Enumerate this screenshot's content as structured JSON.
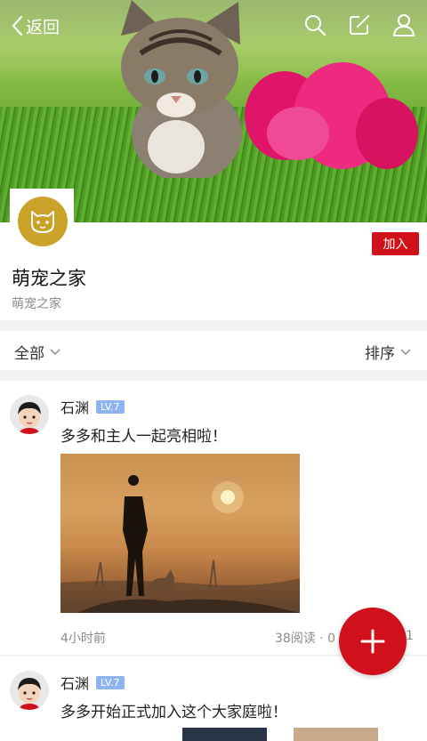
{
  "topbar": {
    "back_label": "返回",
    "icons": [
      "search-icon",
      "edit-icon",
      "user-icon"
    ]
  },
  "group": {
    "name": "萌宠之家",
    "subtitle": "萌宠之家",
    "join_label": "加入",
    "avatar_icon": "cat-icon"
  },
  "filter": {
    "all_label": "全部",
    "sort_label": "排序"
  },
  "posts": [
    {
      "author": "石渊",
      "level": "LV.7",
      "text": "多多和主人一起亮相啦！",
      "time": "4小时前",
      "reads": "38阅读 · 0",
      "extra": "1"
    },
    {
      "author": "石渊",
      "level": "LV.7",
      "text": "多多开始正式加入这个大家庭啦！"
    }
  ],
  "fab_icon": "plus-icon",
  "colors": {
    "accent": "#d0111b",
    "level_badge": "#8db4ef",
    "group_avatar": "#c9a227"
  }
}
